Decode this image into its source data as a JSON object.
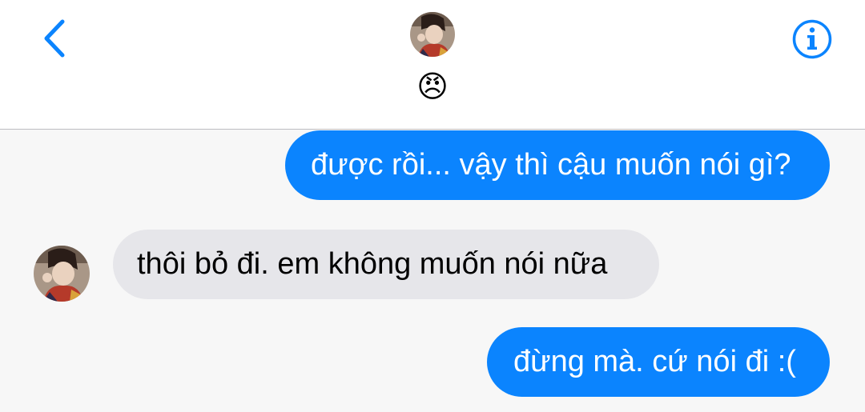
{
  "header": {
    "back_icon": "chevron-left-icon",
    "info_icon": "info-circle-icon",
    "contact_avatar": "contact-photo",
    "contact_name": "😠"
  },
  "messages": [
    {
      "direction": "outgoing",
      "text": "được rồi... vậy thì cậu muốn nói gì?"
    },
    {
      "direction": "incoming",
      "text": "thôi bỏ đi. em không muốn nói nữa"
    },
    {
      "direction": "outgoing",
      "text": "đừng mà. cứ nói đi :("
    }
  ],
  "colors": {
    "accent": "#0b84fe",
    "outgoing_bubble": "#0b84fe",
    "incoming_bubble": "#e6e6ea",
    "chat_background": "#f7f7f7",
    "header_background": "#ffffff"
  }
}
